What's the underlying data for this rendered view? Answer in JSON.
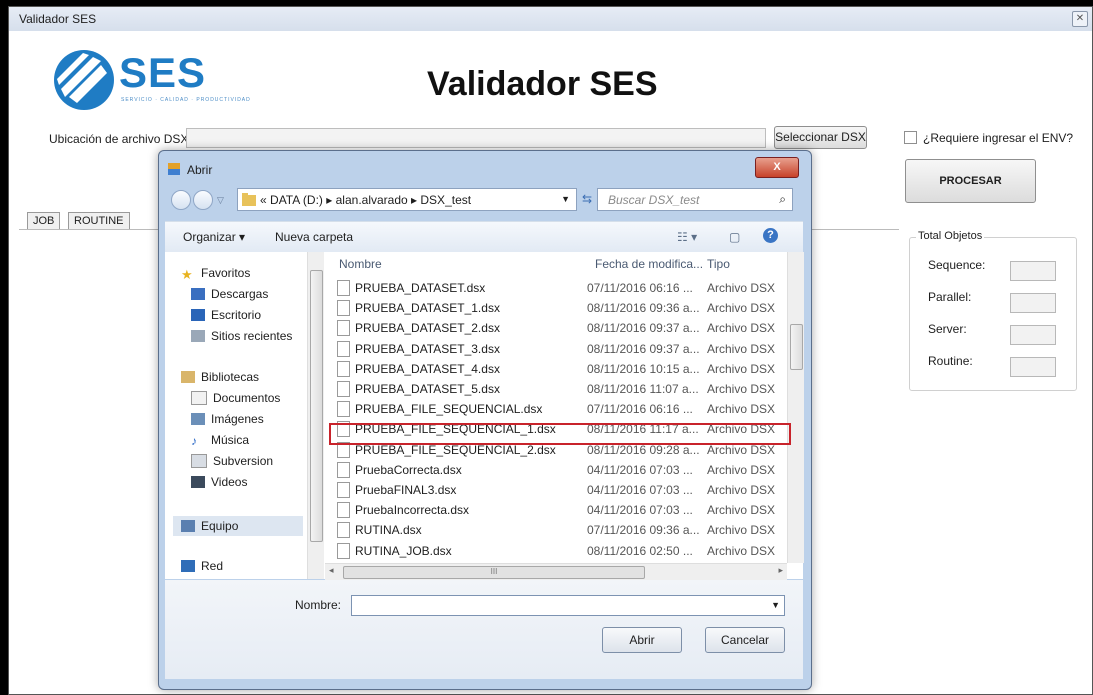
{
  "app": {
    "title": "Validador SES",
    "heading": "Validador SES",
    "logo_text": "SES",
    "logo_sub": "SERVICIO · CALIDAD · PRODUCTIVIDAD",
    "file_label": "Ubicación de archivo DSX :",
    "file_value": "",
    "select_button": "Seleccionar DSX",
    "env_checkbox_label": "¿Requiere ingresar el ENV?",
    "process_button": "PROCESAR",
    "tabs": [
      "JOB",
      "ROUTINE"
    ],
    "totals": {
      "title": "Total Objetos",
      "items": [
        "Sequence:",
        "Parallel:",
        "Server:",
        "Routine:"
      ]
    }
  },
  "dialog": {
    "title": "Abrir",
    "close": "X",
    "breadcrumb": [
      "«",
      "DATA (D:)",
      "alan.alvarado",
      "DSX_test"
    ],
    "search_placeholder": "Buscar DSX_test",
    "toolbar": {
      "organize": "Organizar ▾",
      "new_folder": "Nueva carpeta"
    },
    "nav": {
      "favorites": "Favoritos",
      "downloads": "Descargas",
      "desktop": "Escritorio",
      "recent": "Sitios recientes",
      "libraries": "Bibliotecas",
      "documents": "Documentos",
      "images": "Imágenes",
      "music": "Música",
      "subversion": "Subversion",
      "videos": "Videos",
      "computer": "Equipo",
      "network": "Red"
    },
    "columns": {
      "name": "Nombre",
      "date": "Fecha de modifica...",
      "type": "Tipo"
    },
    "files": [
      {
        "name": "PRUEBA_DATASET.dsx",
        "date": "07/11/2016 06:16 ...",
        "type": "Archivo DSX"
      },
      {
        "name": "PRUEBA_DATASET_1.dsx",
        "date": "08/11/2016 09:36 a...",
        "type": "Archivo DSX"
      },
      {
        "name": "PRUEBA_DATASET_2.dsx",
        "date": "08/11/2016 09:37 a...",
        "type": "Archivo DSX"
      },
      {
        "name": "PRUEBA_DATASET_3.dsx",
        "date": "08/11/2016 09:37 a...",
        "type": "Archivo DSX"
      },
      {
        "name": "PRUEBA_DATASET_4.dsx",
        "date": "08/11/2016 10:15 a...",
        "type": "Archivo DSX"
      },
      {
        "name": "PRUEBA_DATASET_5.dsx",
        "date": "08/11/2016 11:07 a...",
        "type": "Archivo DSX"
      },
      {
        "name": "PRUEBA_FILE_SEQUENCIAL.dsx",
        "date": "07/11/2016 06:16 ...",
        "type": "Archivo DSX"
      },
      {
        "name": "PRUEBA_FILE_SEQUENCIAL_1.dsx",
        "date": "08/11/2016 11:17 a...",
        "type": "Archivo DSX"
      },
      {
        "name": "PRUEBA_FILE_SEQUENCIAL_2.dsx",
        "date": "08/11/2016 09:28 a...",
        "type": "Archivo DSX"
      },
      {
        "name": "PruebaCorrecta.dsx",
        "date": "04/11/2016 07:03 ...",
        "type": "Archivo DSX"
      },
      {
        "name": "PruebaFINAL3.dsx",
        "date": "04/11/2016 07:03 ...",
        "type": "Archivo DSX"
      },
      {
        "name": "PruebaIncorrecta.dsx",
        "date": "04/11/2016 07:03 ...",
        "type": "Archivo DSX"
      },
      {
        "name": "RUTINA.dsx",
        "date": "07/11/2016 09:36 a...",
        "type": "Archivo DSX"
      },
      {
        "name": "RUTINA_JOB.dsx",
        "date": "08/11/2016 02:50 ...",
        "type": "Archivo DSX"
      }
    ],
    "hscroll_thumb": "III",
    "name_label": "Nombre:",
    "name_value": "",
    "open_button": "Abrir",
    "cancel_button": "Cancelar"
  }
}
